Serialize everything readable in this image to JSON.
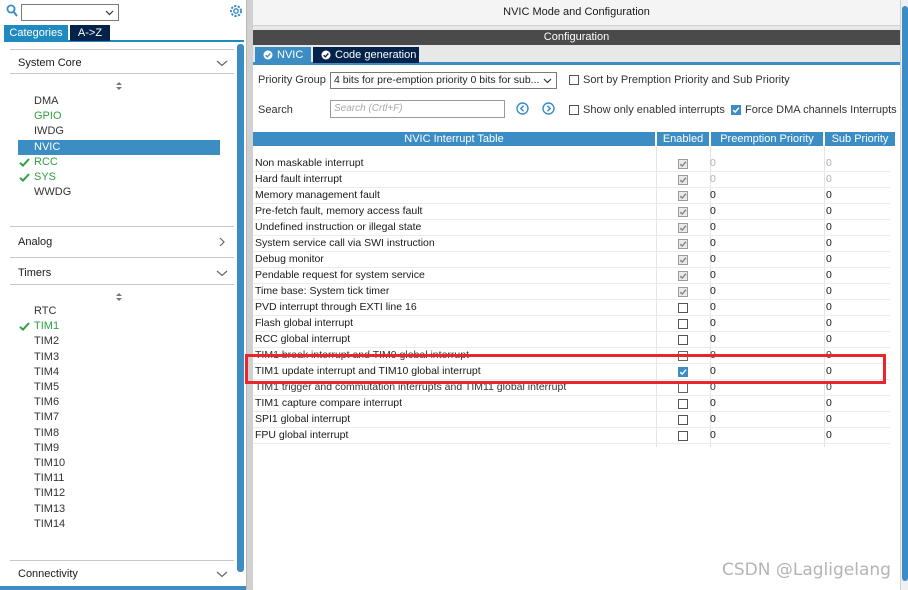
{
  "left": {
    "tabs": {
      "categories": "Categories",
      "az": "A->Z"
    },
    "sections": {
      "system_core": "System Core",
      "analog": "Analog",
      "timers": "Timers",
      "connectivity": "Connectivity"
    },
    "system_core_items": [
      {
        "label": "DMA",
        "state": "normal"
      },
      {
        "label": "GPIO",
        "state": "green"
      },
      {
        "label": "IWDG",
        "state": "normal"
      },
      {
        "label": "NVIC",
        "state": "selected"
      },
      {
        "label": "RCC",
        "state": "green-check"
      },
      {
        "label": "SYS",
        "state": "green-check"
      },
      {
        "label": "WWDG",
        "state": "normal"
      }
    ],
    "timer_items": [
      {
        "label": "RTC",
        "state": "normal"
      },
      {
        "label": "TIM1",
        "state": "green-check"
      },
      {
        "label": "TIM2",
        "state": "normal"
      },
      {
        "label": "TIM3",
        "state": "normal"
      },
      {
        "label": "TIM4",
        "state": "normal"
      },
      {
        "label": "TIM5",
        "state": "normal"
      },
      {
        "label": "TIM6",
        "state": "normal"
      },
      {
        "label": "TIM7",
        "state": "normal"
      },
      {
        "label": "TIM8",
        "state": "normal"
      },
      {
        "label": "TIM9",
        "state": "normal"
      },
      {
        "label": "TIM10",
        "state": "normal"
      },
      {
        "label": "TIM11",
        "state": "normal"
      },
      {
        "label": "TIM12",
        "state": "normal"
      },
      {
        "label": "TIM13",
        "state": "normal"
      },
      {
        "label": "TIM14",
        "state": "normal"
      }
    ]
  },
  "right": {
    "mode_title": "NVIC Mode and Configuration",
    "config_title": "Configuration",
    "tabs": {
      "nvic": "NVIC",
      "code_generation": "Code generation"
    },
    "priority_group_label": "Priority Group",
    "priority_group_value": "4 bits for pre-emption priority 0 bits for sub...",
    "sort_label": "Sort by Premption Priority and Sub Priority",
    "search_label": "Search",
    "search_placeholder": "Search (Crtl+F)",
    "show_enabled_label": "Show only enabled interrupts",
    "force_dma_label": "Force DMA channels Interrupts",
    "checks": {
      "sort": false,
      "show_enabled": false,
      "force_dma": true
    },
    "table": {
      "headers": [
        "NVIC Interrupt Table",
        "Enabled",
        "Preemption Priority",
        "Sub Priority"
      ],
      "rows": [
        {
          "name": "Non maskable interrupt",
          "enabled": true,
          "locked": true,
          "preemption": "0",
          "sub": "0",
          "gray": true
        },
        {
          "name": "Hard fault interrupt",
          "enabled": true,
          "locked": true,
          "preemption": "0",
          "sub": "0",
          "gray": true
        },
        {
          "name": "Memory management fault",
          "enabled": true,
          "locked": true,
          "preemption": "0",
          "sub": "0",
          "gray": false
        },
        {
          "name": "Pre-fetch fault, memory access fault",
          "enabled": true,
          "locked": true,
          "preemption": "0",
          "sub": "0",
          "gray": false
        },
        {
          "name": "Undefined instruction or illegal state",
          "enabled": true,
          "locked": true,
          "preemption": "0",
          "sub": "0",
          "gray": false
        },
        {
          "name": "System service call via SWI instruction",
          "enabled": true,
          "locked": true,
          "preemption": "0",
          "sub": "0",
          "gray": false
        },
        {
          "name": "Debug monitor",
          "enabled": true,
          "locked": true,
          "preemption": "0",
          "sub": "0",
          "gray": false
        },
        {
          "name": "Pendable request for system service",
          "enabled": true,
          "locked": true,
          "preemption": "0",
          "sub": "0",
          "gray": false
        },
        {
          "name": "Time base: System tick timer",
          "enabled": true,
          "locked": true,
          "preemption": "0",
          "sub": "0",
          "gray": false
        },
        {
          "name": "PVD interrupt through EXTI line 16",
          "enabled": false,
          "locked": false,
          "preemption": "0",
          "sub": "0",
          "gray": false
        },
        {
          "name": "Flash global interrupt",
          "enabled": false,
          "locked": false,
          "preemption": "0",
          "sub": "0",
          "gray": false
        },
        {
          "name": "RCC global interrupt",
          "enabled": false,
          "locked": false,
          "preemption": "0",
          "sub": "0",
          "gray": false
        },
        {
          "name": "TIM1 break interrupt and TIM9 global interrupt",
          "enabled": false,
          "locked": false,
          "preemption": "0",
          "sub": "0",
          "gray": false,
          "obscured": true
        },
        {
          "name": "TIM1 update interrupt and TIM10 global interrupt",
          "enabled": true,
          "locked": false,
          "preemption": "0",
          "sub": "0",
          "gray": false
        },
        {
          "name": "TIM1 trigger and commutation interrupts and TIM11 global interrupt",
          "enabled": false,
          "locked": false,
          "preemption": "0",
          "sub": "0",
          "gray": false,
          "obscured": true
        },
        {
          "name": "TIM1 capture compare interrupt",
          "enabled": false,
          "locked": false,
          "preemption": "0",
          "sub": "0",
          "gray": false
        },
        {
          "name": "SPI1 global interrupt",
          "enabled": false,
          "locked": false,
          "preemption": "0",
          "sub": "0",
          "gray": false
        },
        {
          "name": "FPU global interrupt",
          "enabled": false,
          "locked": false,
          "preemption": "0",
          "sub": "0",
          "gray": false
        }
      ]
    }
  },
  "watermark": "CSDN @Lagligelang",
  "colors": {
    "accent": "#3c8dc4",
    "dark_tab": "#03234b",
    "highlight": "#e8262c",
    "green": "#2ea043"
  }
}
